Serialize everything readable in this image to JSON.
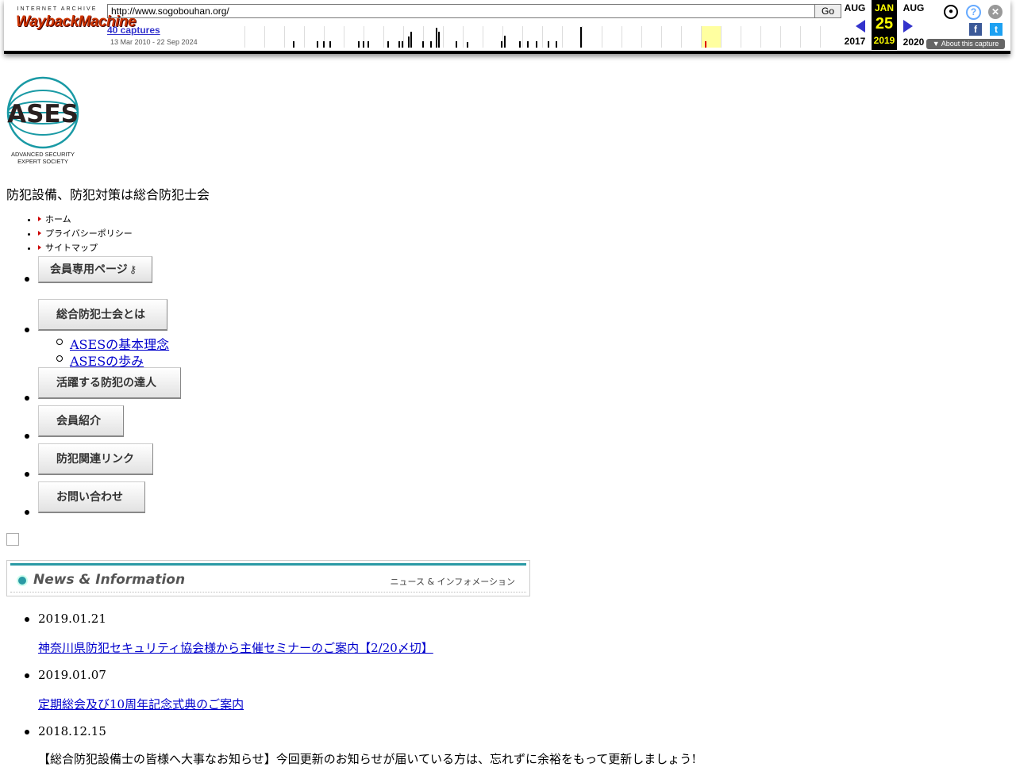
{
  "wayback": {
    "logo_top": "INTERNET ARCHIVE",
    "logo_main": "WaybackMachine",
    "url": "http://www.sogobouhan.org/",
    "go_label": "Go",
    "captures": "40 captures",
    "date_range": "13 Mar 2010 - 22 Sep 2024",
    "prev_month": "AUG",
    "prev_year": "2017",
    "cur_month": "JAN",
    "cur_day": "25",
    "cur_year": "2019",
    "next_month": "AUG",
    "next_year": "2020",
    "about": "About this capture"
  },
  "logo": {
    "name": "ASES",
    "line1": "ADVANCED SECURITY",
    "line2": "EXPERT SOCIETY"
  },
  "tagline": "防犯設備、防犯対策は総合防犯士会",
  "util_links": [
    "ホーム",
    "プライバシーポリシー",
    "サイトマップ"
  ],
  "nav": {
    "members": "会員専用ページ",
    "about": "総合防犯士会とは",
    "about_sub": [
      "ASESの基本理念",
      "ASESの歩み"
    ],
    "experts": "活躍する防犯の達人",
    "member_intro": "会員紹介",
    "links": "防犯関連リンク",
    "contact": "お問い合わせ"
  },
  "news_header": {
    "title": "News & Information",
    "subtitle": "ニュース & インフォメーション"
  },
  "news": [
    {
      "date": "2019.01.21",
      "title": "神奈川県防犯セキュリティ協会様から主催セミナーのご案内【2/20〆切】"
    },
    {
      "date": "2019.01.07",
      "title": "定期総会及び10周年記念式典のご案内"
    },
    {
      "date": "2018.12.15",
      "text": "【総合防犯設備士の皆様へ大事なお知らせ】今回更新のお知らせが届いている方は、忘れずに余裕をもって更新しましょう!"
    }
  ],
  "colors": {
    "accent": "#2a9aa5",
    "link": "#0000cc",
    "wayback_highlight": "#ffff00"
  }
}
